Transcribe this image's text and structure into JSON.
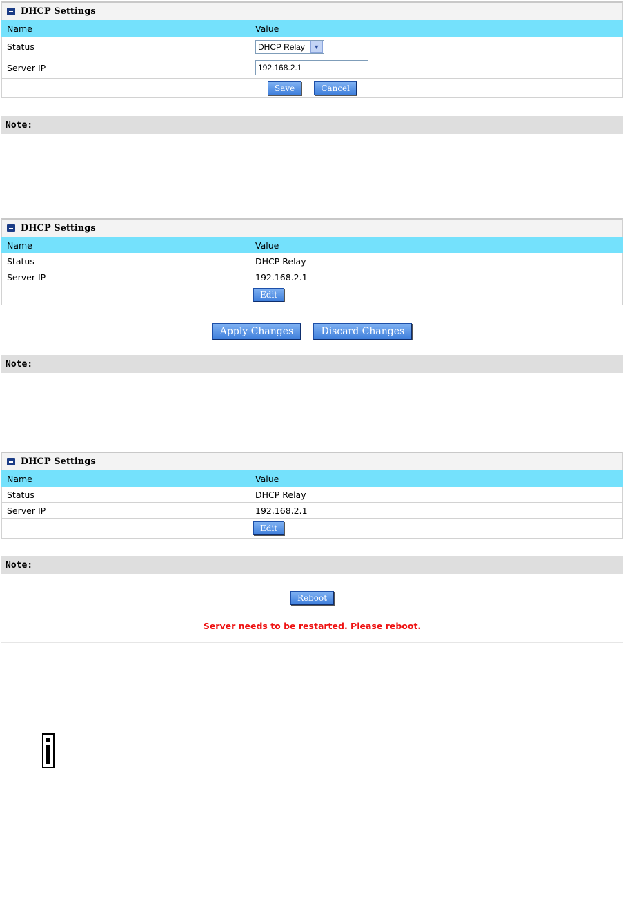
{
  "panel_title": "DHCP Settings",
  "col_name": "Name",
  "col_value": "Value",
  "rows": {
    "status_label": "Status",
    "server_ip_label": "Server IP"
  },
  "panel1": {
    "status_select_value": "DHCP Relay",
    "server_ip_value": "192.168.2.1",
    "save_label": "Save",
    "cancel_label": "Cancel"
  },
  "panel2": {
    "status_value": "DHCP Relay",
    "server_ip_value": "192.168.2.1",
    "edit_label": "Edit",
    "apply_label": "Apply Changes",
    "discard_label": "Discard Changes"
  },
  "panel3": {
    "status_value": "DHCP Relay",
    "server_ip_value": "192.168.2.1",
    "edit_label": "Edit",
    "reboot_label": "Reboot",
    "warning": "Server needs to be restarted. Please reboot."
  },
  "note_label": "Note:",
  "icons": {
    "header": "collapse-icon",
    "info": "info-icon"
  },
  "colors": {
    "header_row": "#74e1fc",
    "button": "#4f8be0",
    "warning": "#ee1111"
  }
}
